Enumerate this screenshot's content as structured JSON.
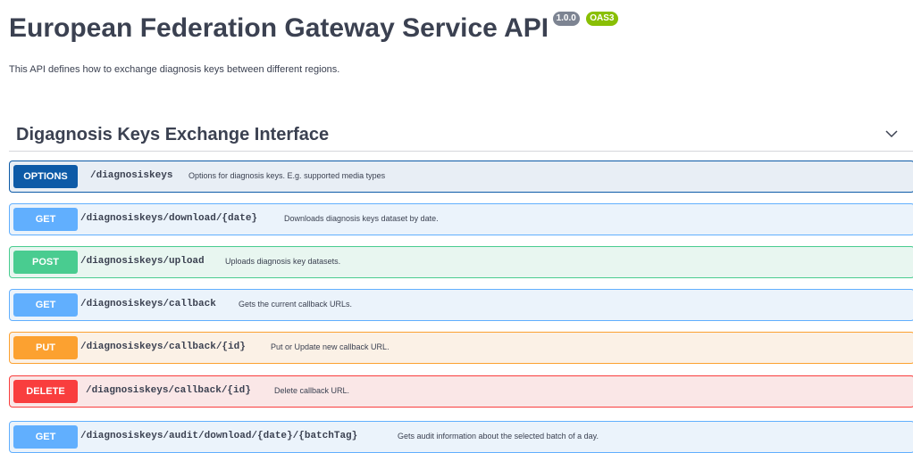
{
  "header": {
    "title": "European Federation Gateway Service API",
    "version_badge": "1.0.0",
    "oas_badge": "OAS3",
    "description": "This API defines how to exchange diagnosis keys between different regions."
  },
  "section": {
    "title": "Digagnosis Keys Exchange Interface",
    "toggle_icon": "chevron-down-icon"
  },
  "operations": [
    {
      "method": "OPTIONS",
      "path": "/diagnosiskeys",
      "summary": "Options for diagnosis keys. E.g. supported media types",
      "color": "#0d5aa7",
      "bg": "#e8eef5",
      "border": "#0d5aa7"
    },
    {
      "method": "GET",
      "path": "/diagnosiskeys/download/{date}",
      "summary": "Downloads diagnosis keys dataset by date.",
      "color": "#61affe",
      "bg": "#ebf3fb",
      "border": "#61affe"
    },
    {
      "method": "POST",
      "path": "/diagnosiskeys/upload",
      "summary": "Uploads diagnosis key datasets.",
      "color": "#49cc90",
      "bg": "#e8f6f0",
      "border": "#49cc90"
    },
    {
      "method": "GET",
      "path": "/diagnosiskeys/callback",
      "summary": "Gets the current callback URLs.",
      "color": "#61affe",
      "bg": "#ebf3fb",
      "border": "#61affe"
    },
    {
      "method": "PUT",
      "path": "/diagnosiskeys/callback/{id}",
      "summary": "Put or Update new callback URL.",
      "color": "#fca130",
      "bg": "#fbf1e6",
      "border": "#fca130"
    },
    {
      "method": "DELETE",
      "path": "/diagnosiskeys/callback/{id}",
      "summary": "Delete callback URL.",
      "color": "#f93e3e",
      "bg": "#fae7e7",
      "border": "#f93e3e"
    },
    {
      "method": "GET",
      "path": "/diagnosiskeys/audit/download/{date}/{batchTag}",
      "summary": "Gets audit information about the selected batch of a day.",
      "color": "#61affe",
      "bg": "#ebf3fb",
      "border": "#61affe"
    }
  ]
}
